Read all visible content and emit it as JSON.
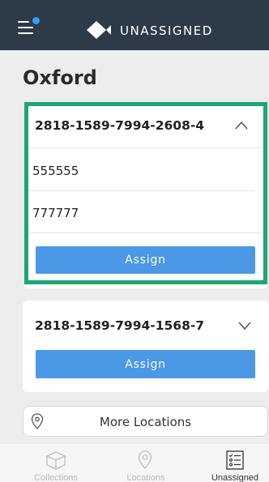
{
  "header": {
    "title": "UNASSIGNED",
    "menu_icon": "menu-icon",
    "notification_color": "#3d9be9",
    "logo_icon": "diamond-logo-icon",
    "background": "#2d3a48"
  },
  "location": {
    "name": "Oxford"
  },
  "cards": [
    {
      "id": "2818-1589-7994-2608-4",
      "expanded": true,
      "fields": [
        "555555",
        "777777"
      ],
      "assign_label": "Assign"
    },
    {
      "id": "2818-1589-7994-1568-7",
      "expanded": false,
      "assign_label": "Assign"
    }
  ],
  "highlight_color": "#1ba673",
  "accent_color": "#4a98e6",
  "more_locations": {
    "label": "More Locations",
    "icon": "location-pin-icon"
  },
  "bottom_nav": {
    "items": [
      {
        "label": "Collections",
        "icon": "box-icon",
        "active": false
      },
      {
        "label": "Locations",
        "icon": "location-pin-icon",
        "active": false
      },
      {
        "label": "Unassigned",
        "icon": "checklist-icon",
        "active": true
      }
    ]
  }
}
